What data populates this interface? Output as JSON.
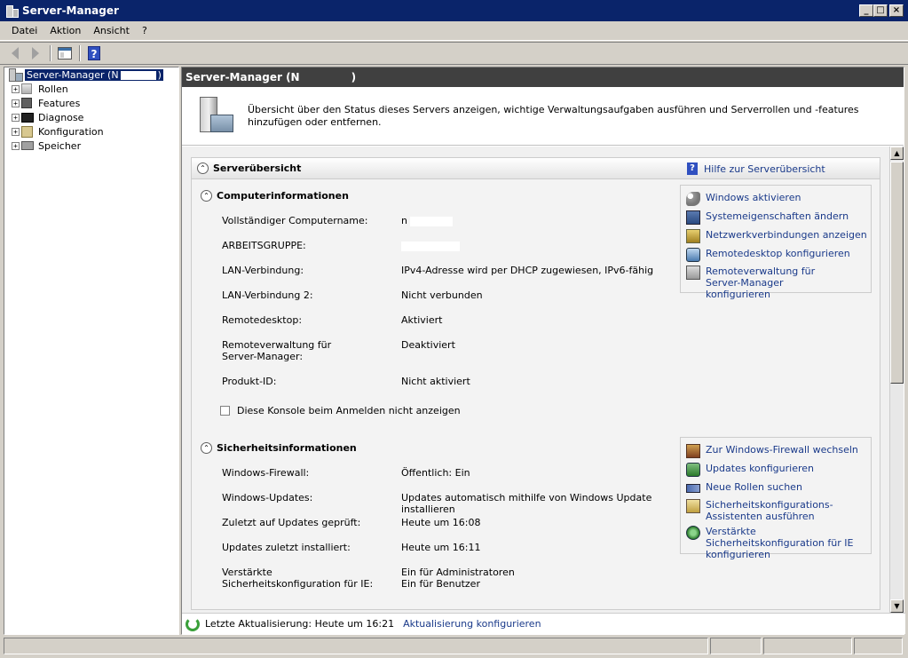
{
  "window": {
    "title": "Server-Manager",
    "controls": {
      "minimize": "_",
      "maximize": "□",
      "close": "×"
    }
  },
  "menu": [
    "Datei",
    "Aktion",
    "Ansicht",
    "?"
  ],
  "tree": {
    "root": "Server-Manager (N",
    "root_suffix": ")",
    "children": [
      {
        "label": "Rollen",
        "expander": "+"
      },
      {
        "label": "Features",
        "expander": "+"
      },
      {
        "label": "Diagnose",
        "expander": "+"
      },
      {
        "label": "Konfiguration",
        "expander": "+"
      },
      {
        "label": "Speicher",
        "expander": "+"
      }
    ]
  },
  "main": {
    "header": "Server-Manager (N",
    "header_suffix": ")",
    "intro": "Übersicht über den Status dieses Servers anzeigen, wichtige Verwaltungsaufgaben ausführen und Serverrollen und -features hinzufügen oder entfernen.",
    "section": {
      "title": "Serverübersicht",
      "help_link": "Hilfe zur Serverübersicht"
    },
    "computer_info": {
      "title": "Computerinformationen",
      "rows": [
        {
          "key": "Vollständiger Computername:",
          "value": "n"
        },
        {
          "key": "ARBEITSGRUPPE:",
          "value": ""
        },
        {
          "key": "LAN-Verbindung:",
          "value": "IPv4-Adresse wird per DHCP zugewiesen, IPv6-fähig"
        },
        {
          "key": "LAN-Verbindung 2:",
          "value": "Nicht verbunden"
        },
        {
          "key": "Remotedesktop:",
          "value": "Aktiviert"
        },
        {
          "key": "Remoteverwaltung für Server-Manager:",
          "value": "Deaktiviert"
        },
        {
          "key": "Produkt-ID:",
          "value": "Nicht aktiviert"
        }
      ],
      "checkbox_label": "Diese Konsole beim Anmelden nicht anzeigen",
      "actions": [
        "Windows aktivieren",
        "Systemeigenschaften ändern",
        "Netzwerkverbindungen anzeigen",
        "Remotedesktop konfigurieren",
        "Remoteverwaltung für Server-Manager konfigurieren"
      ]
    },
    "security_info": {
      "title": "Sicherheitsinformationen",
      "rows": [
        {
          "key": "Windows-Firewall:",
          "value": "Öffentlich: Ein"
        },
        {
          "key": "Windows-Updates:",
          "value": "Updates automatisch mithilfe von Windows Update installieren"
        },
        {
          "key": "Zuletzt auf Updates geprüft:",
          "value": "Heute um 16:08"
        },
        {
          "key": "Updates zuletzt installiert:",
          "value": "Heute um 16:11"
        },
        {
          "key": "Verstärkte Sicherheitskonfiguration für IE:",
          "value": "Ein für Administratoren",
          "value2": "Ein für Benutzer"
        }
      ],
      "actions": [
        "Zur Windows-Firewall wechseln",
        "Updates konfigurieren",
        "Neue Rollen suchen",
        "Sicherheitskonfigurations-Assistenten ausführen",
        "Verstärkte Sicherheitskonfiguration für IE konfigurieren"
      ]
    },
    "footer": {
      "last_update": "Letzte Aktualisierung: Heute um 16:21",
      "configure_link": "Aktualisierung konfigurieren"
    }
  },
  "icons": {
    "back": "back-arrow-icon",
    "forward": "forward-arrow-icon",
    "console": "show-hide-console-tree-icon",
    "help": "help-icon"
  }
}
